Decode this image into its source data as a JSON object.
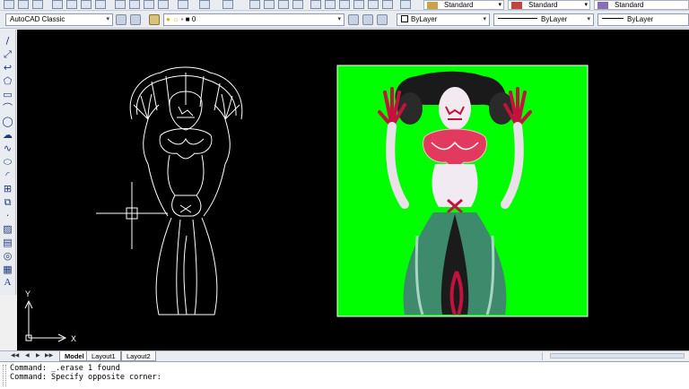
{
  "toolbar_top": {
    "text_style": "Standard",
    "dim_style": "Standard",
    "table_style": "Standard"
  },
  "toolbar_workspace": {
    "workspace": "AutoCAD Classic",
    "layer": "0",
    "color": "ByLayer",
    "linetype": "ByLayer",
    "lineweight": "ByLayer"
  },
  "colors": {
    "canvas": "#000000",
    "image_bg": "#00ff00",
    "wireframe": "#ffffff"
  },
  "ucs": {
    "y_label": "Y",
    "x_label": "X"
  },
  "tabs": [
    "Model",
    "Layout1",
    "Layout2"
  ],
  "command": {
    "line1": "Command:  _.erase 1 found",
    "line2": "Command: Specify opposite corner:"
  }
}
